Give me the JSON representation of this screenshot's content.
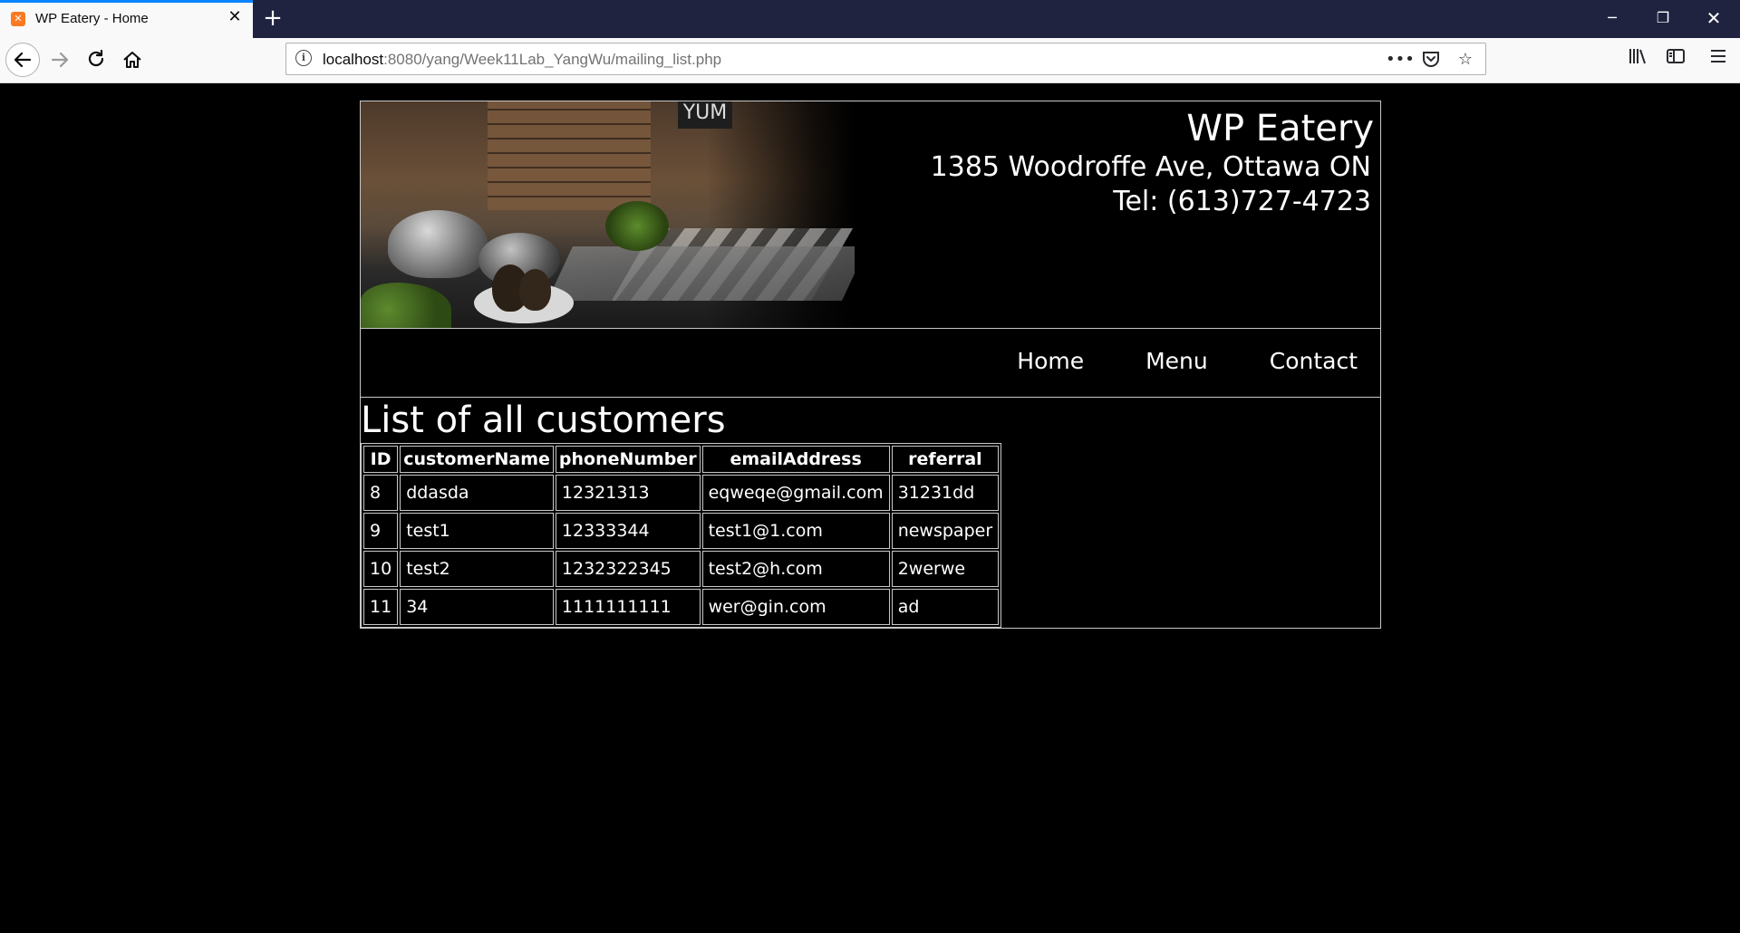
{
  "browser": {
    "tab_title": "WP Eatery - Home",
    "tab_close": "✕",
    "new_tab": "+",
    "url_host": "localhost",
    "url_rest": ":8080/yang/Week11Lab_YangWu/mailing_list.php"
  },
  "site": {
    "name": "WP Eatery",
    "address": "1385 Woodroffe Ave, Ottawa ON",
    "phone": "Tel: (613)727-4723",
    "sign": "YUM"
  },
  "nav": {
    "items": [
      {
        "label": "Home"
      },
      {
        "label": "Menu"
      },
      {
        "label": "Contact"
      }
    ]
  },
  "main": {
    "heading": "List of all customers",
    "table": {
      "columns": [
        "ID",
        "customerName",
        "phoneNumber",
        "emailAddress",
        "referral"
      ],
      "rows": [
        [
          "8",
          "ddasda",
          "12321313",
          "eqweqe@gmail.com",
          "31231dd"
        ],
        [
          "9",
          "test1",
          "12333344",
          "test1@1.com",
          "newspaper"
        ],
        [
          "10",
          "test2",
          "1232322345",
          "test2@h.com",
          "2werwe"
        ],
        [
          "11",
          "34",
          "1111111111",
          "wer@gin.com",
          "ad"
        ]
      ]
    }
  },
  "icons": {
    "favicon": "xampp-favicon",
    "back": "back-arrow-icon",
    "forward": "forward-arrow-icon",
    "reload": "reload-icon",
    "home": "home-icon",
    "info": "info-icon",
    "more": "more-dots-icon",
    "pocket": "pocket-icon",
    "bookmark": "star-icon",
    "library": "library-icon",
    "sidebar": "sidebar-icon",
    "menu": "hamburger-menu-icon"
  },
  "colors": {
    "page_background": "#000000",
    "text": "#ffffff",
    "tab_accent": "#0a84ff",
    "tabbar": "#202340"
  }
}
